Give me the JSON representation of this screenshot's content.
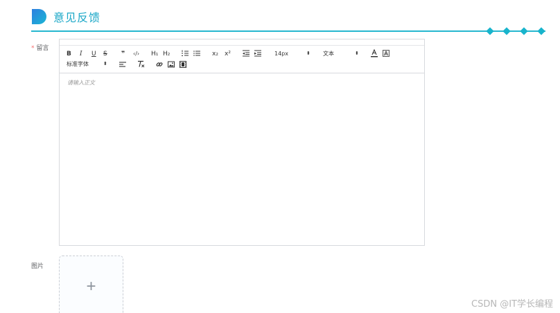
{
  "header": {
    "title": "意见反馈",
    "accent_color": "#1aa7c7",
    "logo_icon": "d-shaped-logo-icon"
  },
  "form": {
    "message_label": "留言",
    "required_mark": "*",
    "image_label": "图片"
  },
  "editor": {
    "placeholder": "请输入正文",
    "toolbar": {
      "bold": "B",
      "italic": "I",
      "underline": "U",
      "strike": "S",
      "blockquote": "❞",
      "code": "‹/›",
      "h1": "H₁",
      "h2": "H₂",
      "sub": "x₂",
      "sup": "x²",
      "size_value": "14px",
      "header_value": "文本",
      "font_value": "标准字体",
      "icons": [
        "bold-icon",
        "italic-icon",
        "underline-icon",
        "strike-icon",
        "blockquote-icon",
        "code-block-icon",
        "h1-icon",
        "h2-icon",
        "ordered-list-icon",
        "bullet-list-icon",
        "subscript-icon",
        "superscript-icon",
        "outdent-icon",
        "indent-icon",
        "size-select",
        "header-select",
        "font-color-icon",
        "background-color-icon",
        "font-select",
        "align-icon",
        "clean-format-icon",
        "link-icon",
        "image-icon",
        "video-icon"
      ]
    }
  },
  "upload": {
    "plus": "+",
    "icon": "plus-icon"
  },
  "watermark": "CSDN @IT学长编程"
}
